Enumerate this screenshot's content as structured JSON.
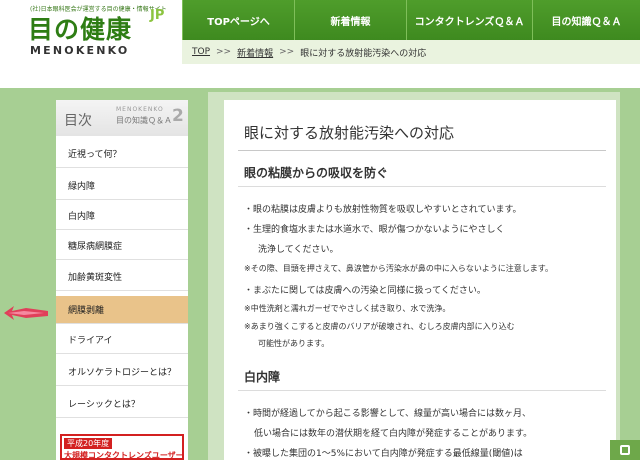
{
  "header": {
    "logo_small": "(社)日本眼科医会が運営する目の健康・情報サイト",
    "logo_main": "目の健康",
    "logo_jp": "JP",
    "logo_sub": "MENOKENKO"
  },
  "nav": {
    "items": [
      {
        "label": "TOPページへ"
      },
      {
        "label": "新着情報"
      },
      {
        "label": "コンタクトレンズＱ＆Ａ"
      },
      {
        "label": "目の知識Ｑ＆Ａ"
      }
    ]
  },
  "breadcrumb": {
    "top": "TOP",
    "sep": ">>",
    "news": "新着情報",
    "current": "眼に対する放射能汚染への対応"
  },
  "sidebar": {
    "toc_title": "目次",
    "toc_mk": "MENOKENKO",
    "toc_sub": "目の知識Ｑ＆Ａ",
    "toc_num": "2",
    "items": [
      {
        "label": "近視って何？"
      },
      {
        "label": "緑内障"
      },
      {
        "label": "白内障"
      },
      {
        "label": "糖尿病網膜症"
      },
      {
        "label": "加齢黄斑変性"
      },
      {
        "label": "網膜剥離"
      },
      {
        "label": "ドライアイ"
      },
      {
        "label": "オルソケラトロジーとは？"
      },
      {
        "label": "レーシックとは？"
      }
    ],
    "active_index": 5,
    "promo_line1": "平成20年度",
    "promo_line2": "大規模コンタクトレンズユーザー"
  },
  "main": {
    "title": "眼に対する放射能汚染への対応",
    "sections": [
      {
        "heading": "眼の粘膜からの吸収を防ぐ",
        "lines": [
          "・眼の粘膜は皮膚よりも放射性物質を吸収しやすいとされています。",
          "・生理的食塩水または水道水で、眼が傷つかないようにやさしく",
          "洗浄してください。",
          "※その際、目頭を押さえて、鼻涙管から汚染水が鼻の中に入らないように注意します。",
          "・まぶたに関しては皮膚への汚染と同様に扱ってください。",
          "※中性洗剤と濡れガーゼでやさしく拭き取り、水で洗浄。",
          "※あまり強くこすると皮膚のバリアが破壊され、むしろ皮膚内部に入り込む",
          "可能性があります。"
        ]
      },
      {
        "heading": "白内障",
        "lines": [
          "・時間が経過してから起こる影響として、線量が高い場合には数ヶ月、",
          "低い場合には数年の潜伏期を経て白内障が発症することがあります。",
          "・被曝した集団の1～5%において白内障が発症する最低線量(閾値)は"
        ]
      }
    ]
  },
  "colors": {
    "nav_green": "#4f9d2b",
    "side_green": "#a7cf93",
    "active_item": "#e9c38a",
    "promo_red": "#d32020"
  }
}
